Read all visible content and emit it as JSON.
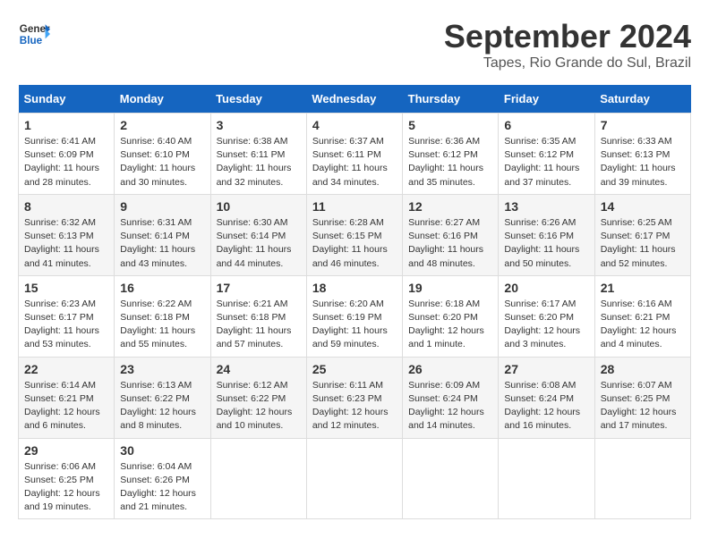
{
  "header": {
    "logo_line1": "General",
    "logo_line2": "Blue",
    "month": "September 2024",
    "location": "Tapes, Rio Grande do Sul, Brazil"
  },
  "weekdays": [
    "Sunday",
    "Monday",
    "Tuesday",
    "Wednesday",
    "Thursday",
    "Friday",
    "Saturday"
  ],
  "weeks": [
    [
      {
        "day": "1",
        "info": "Sunrise: 6:41 AM\nSunset: 6:09 PM\nDaylight: 11 hours\nand 28 minutes."
      },
      {
        "day": "2",
        "info": "Sunrise: 6:40 AM\nSunset: 6:10 PM\nDaylight: 11 hours\nand 30 minutes."
      },
      {
        "day": "3",
        "info": "Sunrise: 6:38 AM\nSunset: 6:11 PM\nDaylight: 11 hours\nand 32 minutes."
      },
      {
        "day": "4",
        "info": "Sunrise: 6:37 AM\nSunset: 6:11 PM\nDaylight: 11 hours\nand 34 minutes."
      },
      {
        "day": "5",
        "info": "Sunrise: 6:36 AM\nSunset: 6:12 PM\nDaylight: 11 hours\nand 35 minutes."
      },
      {
        "day": "6",
        "info": "Sunrise: 6:35 AM\nSunset: 6:12 PM\nDaylight: 11 hours\nand 37 minutes."
      },
      {
        "day": "7",
        "info": "Sunrise: 6:33 AM\nSunset: 6:13 PM\nDaylight: 11 hours\nand 39 minutes."
      }
    ],
    [
      {
        "day": "8",
        "info": "Sunrise: 6:32 AM\nSunset: 6:13 PM\nDaylight: 11 hours\nand 41 minutes."
      },
      {
        "day": "9",
        "info": "Sunrise: 6:31 AM\nSunset: 6:14 PM\nDaylight: 11 hours\nand 43 minutes."
      },
      {
        "day": "10",
        "info": "Sunrise: 6:30 AM\nSunset: 6:14 PM\nDaylight: 11 hours\nand 44 minutes."
      },
      {
        "day": "11",
        "info": "Sunrise: 6:28 AM\nSunset: 6:15 PM\nDaylight: 11 hours\nand 46 minutes."
      },
      {
        "day": "12",
        "info": "Sunrise: 6:27 AM\nSunset: 6:16 PM\nDaylight: 11 hours\nand 48 minutes."
      },
      {
        "day": "13",
        "info": "Sunrise: 6:26 AM\nSunset: 6:16 PM\nDaylight: 11 hours\nand 50 minutes."
      },
      {
        "day": "14",
        "info": "Sunrise: 6:25 AM\nSunset: 6:17 PM\nDaylight: 11 hours\nand 52 minutes."
      }
    ],
    [
      {
        "day": "15",
        "info": "Sunrise: 6:23 AM\nSunset: 6:17 PM\nDaylight: 11 hours\nand 53 minutes."
      },
      {
        "day": "16",
        "info": "Sunrise: 6:22 AM\nSunset: 6:18 PM\nDaylight: 11 hours\nand 55 minutes."
      },
      {
        "day": "17",
        "info": "Sunrise: 6:21 AM\nSunset: 6:18 PM\nDaylight: 11 hours\nand 57 minutes."
      },
      {
        "day": "18",
        "info": "Sunrise: 6:20 AM\nSunset: 6:19 PM\nDaylight: 11 hours\nand 59 minutes."
      },
      {
        "day": "19",
        "info": "Sunrise: 6:18 AM\nSunset: 6:20 PM\nDaylight: 12 hours\nand 1 minute."
      },
      {
        "day": "20",
        "info": "Sunrise: 6:17 AM\nSunset: 6:20 PM\nDaylight: 12 hours\nand 3 minutes."
      },
      {
        "day": "21",
        "info": "Sunrise: 6:16 AM\nSunset: 6:21 PM\nDaylight: 12 hours\nand 4 minutes."
      }
    ],
    [
      {
        "day": "22",
        "info": "Sunrise: 6:14 AM\nSunset: 6:21 PM\nDaylight: 12 hours\nand 6 minutes."
      },
      {
        "day": "23",
        "info": "Sunrise: 6:13 AM\nSunset: 6:22 PM\nDaylight: 12 hours\nand 8 minutes."
      },
      {
        "day": "24",
        "info": "Sunrise: 6:12 AM\nSunset: 6:22 PM\nDaylight: 12 hours\nand 10 minutes."
      },
      {
        "day": "25",
        "info": "Sunrise: 6:11 AM\nSunset: 6:23 PM\nDaylight: 12 hours\nand 12 minutes."
      },
      {
        "day": "26",
        "info": "Sunrise: 6:09 AM\nSunset: 6:24 PM\nDaylight: 12 hours\nand 14 minutes."
      },
      {
        "day": "27",
        "info": "Sunrise: 6:08 AM\nSunset: 6:24 PM\nDaylight: 12 hours\nand 16 minutes."
      },
      {
        "day": "28",
        "info": "Sunrise: 6:07 AM\nSunset: 6:25 PM\nDaylight: 12 hours\nand 17 minutes."
      }
    ],
    [
      {
        "day": "29",
        "info": "Sunrise: 6:06 AM\nSunset: 6:25 PM\nDaylight: 12 hours\nand 19 minutes."
      },
      {
        "day": "30",
        "info": "Sunrise: 6:04 AM\nSunset: 6:26 PM\nDaylight: 12 hours\nand 21 minutes."
      },
      {
        "day": "",
        "info": ""
      },
      {
        "day": "",
        "info": ""
      },
      {
        "day": "",
        "info": ""
      },
      {
        "day": "",
        "info": ""
      },
      {
        "day": "",
        "info": ""
      }
    ]
  ]
}
